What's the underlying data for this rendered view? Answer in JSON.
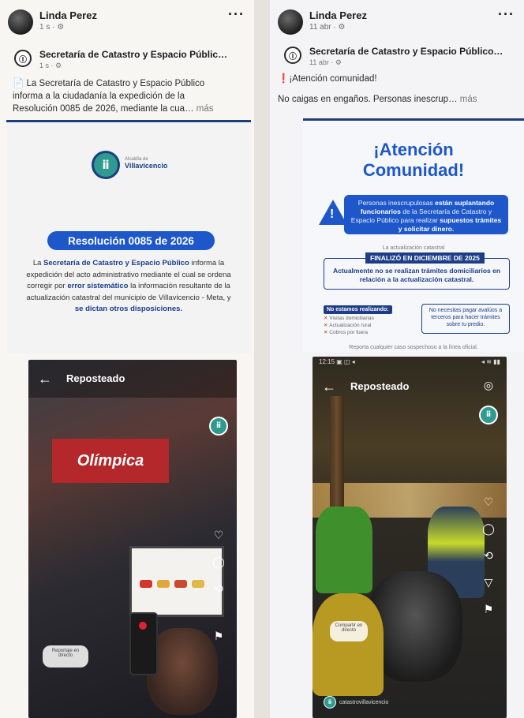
{
  "left_post": {
    "author": "Linda Perez",
    "meta": "1 s · ⚙",
    "more": "···",
    "shared_page": "Secretaría de Catastro y Espacio Públic…",
    "shared_meta": "1 s · ⚙",
    "caption_1": "📄 La Secretaría de Catastro y Espacio Público",
    "caption_2": "informa a la ciudadanía la expedición de la",
    "caption_3": "Resolución 0085 de 2026, mediante la cua…",
    "caption_more": "más",
    "logo_label": "Villavicencio",
    "logo_sub": "Alcaldía de",
    "resolution_title": "Resolución 0085 de 2026",
    "resolution_body_pre": "La ",
    "resolution_body_bold1": "Secretaría de Catastro y Espacio Público",
    "resolution_body_mid": " informa la expedición del acto administrativo mediante el cual se ordena corregir por ",
    "resolution_body_bold2": "error sistemático",
    "resolution_body_post": " la información resultante de la actualización catastral del municipio de Villavicencio - Meta, y ",
    "resolution_body_bold3": "se dictan otros disposiciones."
  },
  "left_reel": {
    "title": "Reposteado",
    "brand": "Olímpica",
    "bubble": "Reportaje en directo"
  },
  "right_post": {
    "author": "Linda Perez",
    "meta": "11 abr · ⚙",
    "more": "···",
    "shared_page": "Secretaría de Catastro y Espacio Público…",
    "shared_meta": "11 abr · ⚙",
    "caption_1": "❗¡Atención comunidad!",
    "caption_2": "No caigas en engaños. Personas inescrup…",
    "caption_more": "más",
    "alert_title_1": "¡Atención",
    "alert_title_2": "Comunidad!",
    "warn_pre": "Personas inescrupulosas ",
    "warn_bold1": "están suplantando funcionarios",
    "warn_mid": " de la Secretaría de Catastro y Espacio Público para realizar ",
    "warn_bold2": "supuestos trámites y solicitar dinero.",
    "small_label": "La actualización catastral",
    "fin_tag": "FINALIZÓ EN DICIEMBRE DE 2025",
    "fin_text": "Actualmente no se realizan trámites domiciliarios en relación a la actualización catastral.",
    "not_tag": "No estamos realizando:",
    "not_items": [
      "Visitas domiciliarias",
      "Actualización rural",
      "Cobros por fuera"
    ],
    "pay_text": "No necesitas pagar avalúos a terceros para hacer trámites sobre tu predio.",
    "footer_note": "Reporta cualquier caso sospechoso a la línea oficial."
  },
  "right_reel": {
    "title": "Reposteado",
    "status_left": "12:15 ▣ ◫ ◂",
    "status_right": "◂ ≋ ▮▮",
    "sello": "Compartir en directo",
    "footer": "catastrovillavicencio"
  }
}
